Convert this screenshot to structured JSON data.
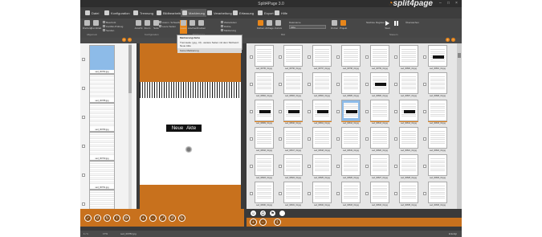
{
  "app": {
    "title": "Split4Page 3.0",
    "logo_prefix": "",
    "logo_text": "split4page"
  },
  "window_controls": [
    "–",
    "□",
    "×"
  ],
  "ribbon_tabs": [
    {
      "label": "Datei"
    },
    {
      "label": "Konfiguration"
    },
    {
      "label": "Trennung"
    },
    {
      "label": "Bildbearbeitung"
    },
    {
      "label": "Markierung"
    },
    {
      "label": "Verarbeitung"
    },
    {
      "label": "Erfassung"
    },
    {
      "label": "Export"
    },
    {
      "label": "Hilfe"
    }
  ],
  "ribbon": {
    "buttons_a": [
      "Drehung",
      "Trennblatt"
    ],
    "options": [
      "Beschnitt",
      "Konflikt-Prüfung",
      "Senden",
      "Umsetzen Querformat"
    ],
    "buttons_b": [
      "Ansicht",
      "Zoom",
      "Seite",
      "Leere",
      "Löschen",
      "Drucken"
    ],
    "checks": [
      "Autom. Schwellw.",
      "Leere Seiten",
      "Weiterleiten",
      "Dichte",
      "Markierung"
    ],
    "buttons_c": [
      "Färben",
      "Abfrage",
      "Zurück",
      "Auswahl"
    ],
    "field_label": "Dateiname",
    "field_value": "Akte",
    "buttons_d": [
      "Ordner",
      "Projekt"
    ],
    "right_labels": [
      "Nächste Register",
      "Start",
      "Überwachen"
    ],
    "groups": [
      "Allgemein",
      "Konfiguration",
      "Markierung",
      "Bild",
      "Steuern"
    ]
  },
  "popup": {
    "items": [
      "Markierungsfarbe",
      "Trennseite (.jpg, .tif) - weitere Seiten mit dem Stichwort: Neue Akte",
      "Keine Markierung"
    ]
  },
  "left_thumbs": [
    {
      "name": "sed_00782.jpg",
      "checked": true
    },
    {
      "name": "sed_00788.jpg",
      "checked": false
    },
    {
      "name": "sed_00789.jpg",
      "checked": false
    },
    {
      "name": "sed_00790.jpg",
      "checked": true
    },
    {
      "name": "sed_00791.jpg",
      "checked": false
    },
    {
      "name": "sed_00792.jpg",
      "checked": false
    }
  ],
  "viewer": {
    "label_word1": "Neue",
    "label_word2": "Akte"
  },
  "grid": {
    "rows": [
      [
        "sed_00795_01.jpg",
        "sed_00796_01.jpg",
        "sed_00797_01.jpg",
        "sed_00798_01.jpg",
        "sed_00799_01.jpg",
        "sed_00800_01.jpg",
        "sed_00801_01.jpg"
      ],
      [
        "sed_00802_01.jpg",
        "sed_00803_01.jpg",
        "sed_00804_01.jpg",
        "sed_00805_01.jpg",
        "sed_00806_01.jpg",
        "sed_00807_01.jpg",
        "sed_00808_01.jpg"
      ],
      [
        "sed_00809_01.jpg",
        "sed_00810_01.jpg",
        "sed_00811_01.jpg",
        "sed_00812_01.jpg",
        "sed_00813_01.jpg",
        "sed_00814_01.jpg",
        "sed_00815_01.jpg"
      ],
      [
        "sed_00816_01.jpg",
        "sed_00817_01.jpg",
        "sed_00818_01.jpg",
        "sed_00819_01.jpg",
        "sed_00820_01.jpg",
        "sed_00821_01.jpg",
        "sed_00822_01.jpg"
      ],
      [
        "sed_00823_01.jpg",
        "sed_00824_01.jpg",
        "sed_00825_01.jpg",
        "sed_00826_01.jpg",
        "sed_00827_01.jpg",
        "sed_00828_01.jpg",
        "sed_00829_01.jpg"
      ],
      [
        "sed_00830_01.jpg",
        "sed_00831_01.jpg",
        "sed_00832_01.jpg",
        "sed_00833_01.jpg",
        "sed_00834_01.jpg",
        "sed_00835_01.jpg",
        "sed_00836_01.jpg"
      ]
    ],
    "stickers": [
      [
        2,
        0
      ],
      [
        2,
        1
      ],
      [
        2,
        2
      ],
      [
        2,
        3
      ],
      [
        2,
        5
      ],
      [
        0,
        6
      ],
      [
        1,
        4
      ]
    ],
    "orange_row": 2,
    "selected": [
      2,
      3
    ]
  },
  "status": {
    "left": "1 / 1",
    "zoom": "17%",
    "file": "sed_00782.jpg",
    "right": "Erledigt"
  },
  "colors": {
    "accent": "#e8861a",
    "panel_bg": "#c8711d",
    "selected_thumb": "#8dbbe8"
  }
}
